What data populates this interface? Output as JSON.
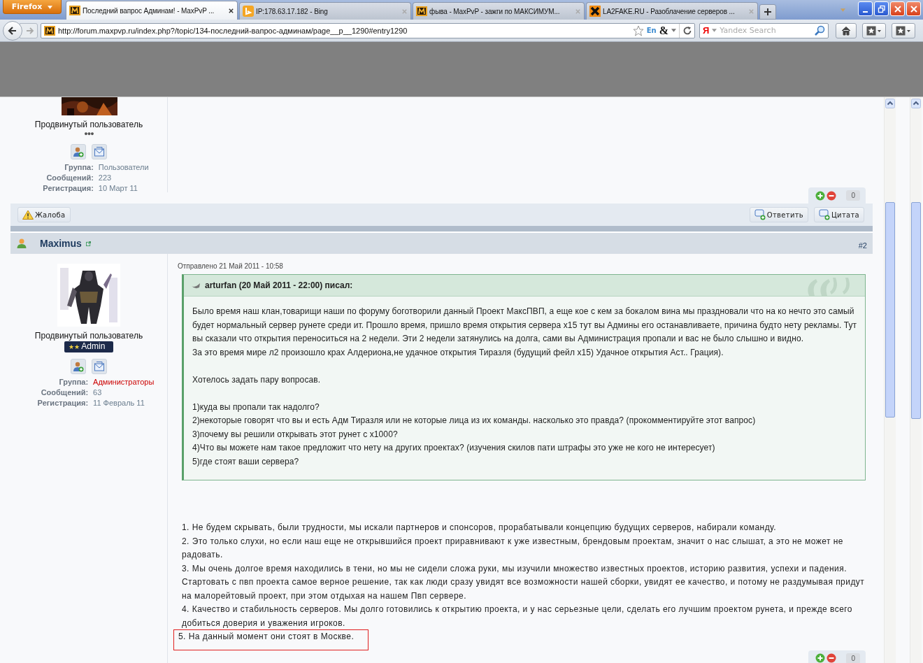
{
  "browser": {
    "menu_button": "Firefox",
    "tabs": [
      {
        "title": "Последний вапрос Админам! - MaxPvP ...",
        "selected": true,
        "kind": "maxpvp"
      },
      {
        "title": "IP:178.63.17.182 - Bing",
        "selected": false,
        "kind": "bing"
      },
      {
        "title": "фыва - MaxPvP - зажги по МАКСИМУМ...",
        "selected": false,
        "kind": "maxpvp"
      },
      {
        "title": "LA2FAKE.RU - Разоблачение серверов ...",
        "selected": false,
        "kind": "cross"
      }
    ],
    "url": "http://forum.maxpvp.ru/index.php?/topic/134-последний-вапрос-админам/page__p__1290#entry1290",
    "language_indicator": "En",
    "ampersand": "&",
    "search": {
      "engine_mark": "Я",
      "placeholder": "Yandex Search"
    }
  },
  "posts": [
    {
      "rank": "Продвинутый пользователь",
      "rank_mark": {
        "kind": "pips",
        "text": "●●●"
      },
      "info": [
        {
          "label": "Группа:",
          "value": "Пользователи",
          "color": "#6a7d8e"
        },
        {
          "label": "Сообщений:",
          "value": "223"
        },
        {
          "label": "Регистрация:",
          "value": "10 Март 11"
        }
      ],
      "reputation": "0",
      "actions": {
        "report": "Жалоба",
        "reply": "Ответить",
        "quote": "Цитата"
      }
    },
    {
      "author": "Maximus",
      "number": "#2",
      "rank": "Продвинутый пользователь",
      "rank_mark": {
        "kind": "badge",
        "stars": "★★",
        "label": "Admin"
      },
      "info": [
        {
          "label": "Группа:",
          "value": "Администраторы",
          "color": "#cc0000"
        },
        {
          "label": "Сообщений:",
          "value": "63"
        },
        {
          "label": "Регистрация:",
          "value": "11 Февраль 11"
        }
      ],
      "posted": "Отправлено 21 Май 2011 - 10:58",
      "quote": {
        "header": "arturfan (20 Май 2011 - 22:00) писал:",
        "paragraphs": [
          [
            "Было время наш клан,товарищи наши по форуму боготворили данный Проект МаксПВП, а еще кое с кем за бокалом вина мы праздновали что на ко нечто это самый будет нормальный сервер рунете среди ит. Прошло время, пришло время открытия сервера x15 тут вы Админы его останавливаете, причина будто нету рекламы. Тут вы сказали что открытия переноситься на 2 недели. Эти 2 недели затянулись на долга, сами вы Администрация пропали и вас не было слышно и видно.",
            "За это время мире л2 произошло крах Алдериона,не удачное открытия Тиразля (будущий фейл x15) Удачное открытия Аст.. Грация)."
          ],
          [
            "Хотелось задать пару вопросав."
          ],
          [
            "1)куда вы пропали так надолго?",
            "2)некоторые говорят что вы и есть Адм Тиразля или не которые лица из их команды. насколько это правда? (прокомментируйте этот вапрос)",
            "3)почему вы решили открывать этот рунет с x1000?",
            "4)Что вы можете нам такое предложит что нету на других проектах? (изучения скилов пати штрафы это уже не кого не интересует)",
            "5)где стоят ваши сервера?"
          ]
        ]
      },
      "reply": [
        {
          "text": "1. Не будем скрывать, были трудности, мы искали партнеров и спонсоров, прорабатывали концепцию будущих серверов, набирали команду.",
          "highlighted": false
        },
        {
          "text": "2. Это только слухи, но если наш еще не открывшийся проект приравнивают к уже известным, брендовым проектам, значит о нас слышат, а это не может не радовать.",
          "highlighted": false
        },
        {
          "text": "3. Мы очень долгое время находились в тени, но мы не сидели сложа руки, мы изучили множество известных проектов, историю развития, успехи и падения. Стартовать с пвп проекта самое верное решение, так как люди сразу увидят все возможности нашей сборки, увидят ее качество, и потому не раздумывая придут на малорейтовый проект, при этом отдыхая на нашем Пвп сервере.",
          "highlighted": false
        },
        {
          "text": "4. Качество и стабильность серверов. Мы долго готовились к открытию проекта, и у нас серьезные цели, сделать его лучшим проектом рунета, и прежде всего добиться доверия и уважения игроков.",
          "highlighted": false
        },
        {
          "text": "5. На данный момент они стоят в Москве.",
          "highlighted": true
        }
      ],
      "reputation": "0"
    }
  ]
}
